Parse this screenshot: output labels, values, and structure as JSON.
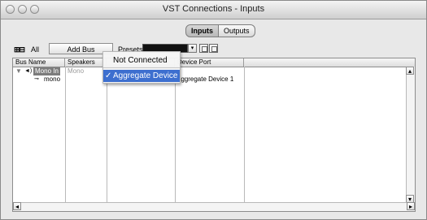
{
  "window": {
    "title": "VST Connections - Inputs"
  },
  "tabs": [
    {
      "label": "Inputs",
      "active": true
    },
    {
      "label": "Outputs",
      "active": false
    }
  ],
  "toolbar": {
    "all_label": "All",
    "expand_icons": "⊞⊟",
    "add_bus_label": "Add Bus",
    "presets_label": "Presets",
    "preset_value": ""
  },
  "table": {
    "headers": [
      "Bus Name",
      "Speakers",
      "",
      "Device Port",
      ""
    ],
    "rows": [
      {
        "bus_name": "Mono In",
        "speakers": "Mono",
        "device_port": ""
      },
      {
        "bus_name": "mono",
        "speakers": "",
        "device_port": "Aggregate Device 1"
      }
    ]
  },
  "dropdown": {
    "items": [
      {
        "label": "Not Connected",
        "checked": false,
        "selected": false
      },
      {
        "label": "Aggregate Device",
        "checked": true,
        "selected": true
      }
    ]
  }
}
